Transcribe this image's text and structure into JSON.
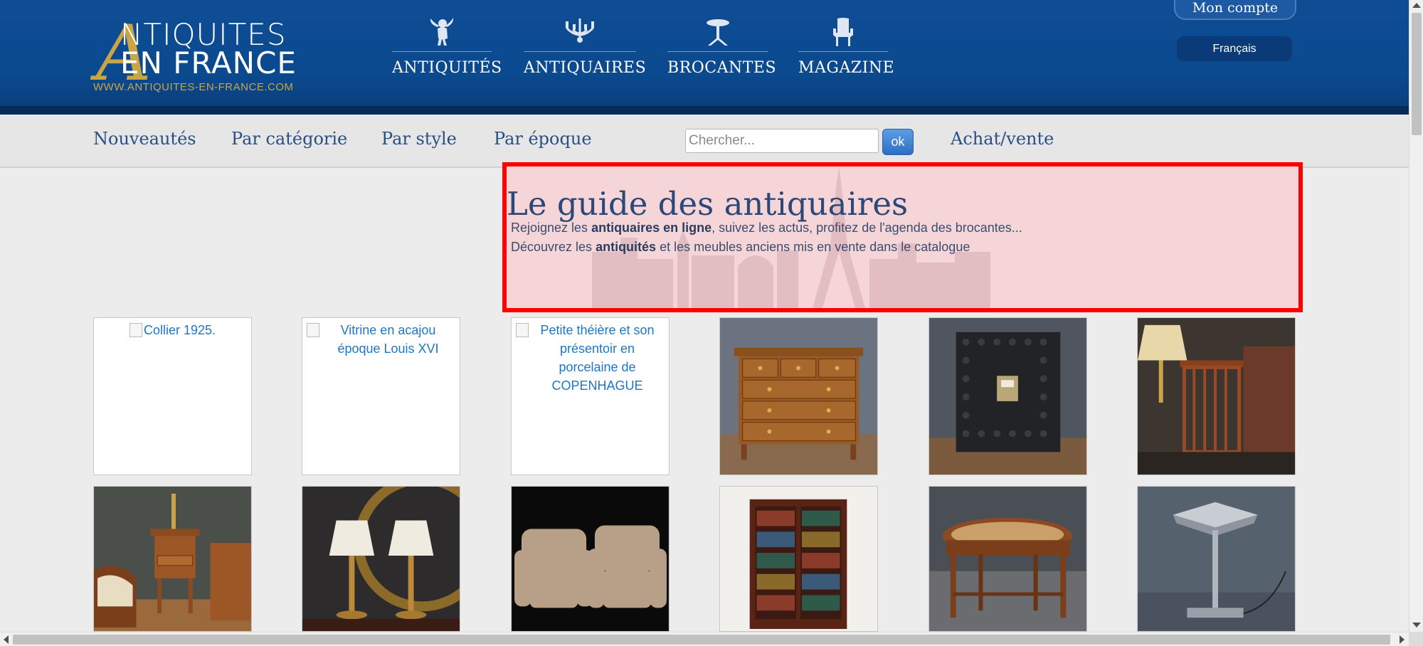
{
  "header": {
    "logo": {
      "big_letter": "A",
      "line1": "NTIQUITES",
      "line2": "EN FRANCE",
      "url": "WWW.ANTIQUITES-EN-FRANCE.COM"
    },
    "nav": [
      {
        "label": "ANTIQUITÉS",
        "icon": "cherub-icon"
      },
      {
        "label": "ANTIQUAIRES",
        "icon": "chandelier-icon"
      },
      {
        "label": "BROCANTES",
        "icon": "pedestal-table-icon"
      },
      {
        "label": "MAGAZINE",
        "icon": "chair-icon"
      }
    ],
    "account": "Mon compte",
    "language": "Français"
  },
  "subnav": {
    "items": [
      "Nouveautés",
      "Par catégorie",
      "Par style",
      "Par époque"
    ],
    "search": {
      "placeholder": "Chercher...",
      "value": ""
    },
    "ok": "ok",
    "buy_sell": "Achat/vente"
  },
  "guide": {
    "title": "Le guide des antiquaires",
    "line1": {
      "before": "Rejoignez les ",
      "bold": "antiquaires en ligne",
      "after": ", suivez les actus, profitez de l'agenda des brocantes..."
    },
    "line2": {
      "before": "Découvrez les ",
      "bold": "antiquités",
      "after": " et les meubles anciens mis en vente dans le catalogue"
    }
  },
  "products": {
    "row1": [
      {
        "alt": "Collier 1925.",
        "broken": true
      },
      {
        "alt": "Vitrine en acajou époque Louis XVI",
        "broken": true
      },
      {
        "alt": "Petite théière et son présentoir en porcelaine de COPENHAGUE",
        "broken": true
      },
      {
        "alt": "",
        "broken": false,
        "kind": "commode"
      },
      {
        "alt": "",
        "broken": false,
        "kind": "safe"
      },
      {
        "alt": "",
        "broken": false,
        "kind": "side-table-lamp"
      }
    ],
    "row2": [
      {
        "kind": "bedside-table"
      },
      {
        "kind": "pair-of-lamps"
      },
      {
        "kind": "pair-of-armchairs"
      },
      {
        "kind": "bookcase"
      },
      {
        "kind": "bench"
      },
      {
        "kind": "desk-lamp"
      }
    ]
  },
  "colors": {
    "header_blue": "#0f4c94",
    "gold": "#c9a548",
    "link_blue": "#2a4e86",
    "highlight_red": "#ff0000"
  }
}
